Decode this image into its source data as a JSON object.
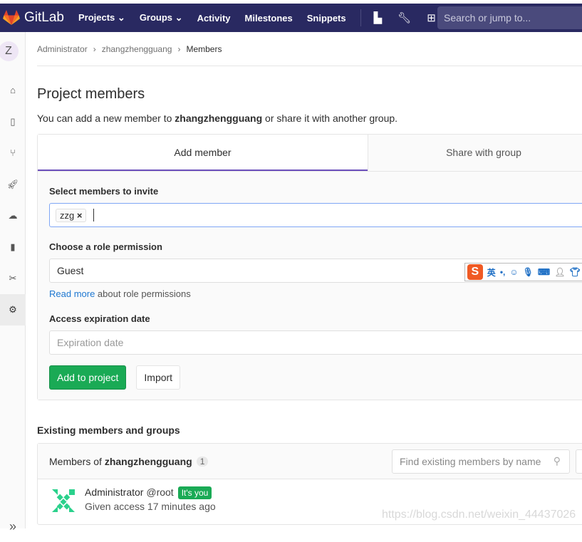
{
  "nav": {
    "brand": "GitLab",
    "items": [
      "Projects",
      "Groups",
      "Activity",
      "Milestones",
      "Snippets"
    ],
    "search_placeholder": "Search or jump to..."
  },
  "sidebar": {
    "avatar_letter": "Z",
    "items": [
      "home-icon",
      "repository-icon",
      "merge-request-icon",
      "ci-cd-icon",
      "operations-icon",
      "wiki-icon",
      "snippets-icon",
      "settings-icon"
    ],
    "active": "settings-icon"
  },
  "breadcrumb": [
    "Administrator",
    "zhangzhengguang",
    "Members"
  ],
  "page": {
    "title": "Project members",
    "lead_prefix": "You can add a new member to ",
    "lead_project": "zhangzhengguang",
    "lead_suffix": " or share it with another group."
  },
  "tabs": [
    "Add member",
    "Share with group"
  ],
  "form": {
    "select_label": "Select members to invite",
    "token": "zzg",
    "role_label": "Choose a role permission",
    "role_value": "Guest",
    "read_more": "Read more",
    "read_more_suffix": " about role permissions",
    "expiration_label": "Access expiration date",
    "expiration_placeholder": "Expiration date",
    "add_button": "Add to project",
    "import_button": "Import"
  },
  "ime": {
    "lang": "英",
    "punct": "•,"
  },
  "existing": {
    "title": "Existing members and groups",
    "members_of": "Members of ",
    "project": "zhangzhengguang",
    "count": "1",
    "find_placeholder": "Find existing members by name",
    "members": [
      {
        "name": "Administrator",
        "username": "@root",
        "badge": "It's you",
        "access": "Given access 17 minutes ago"
      }
    ]
  },
  "watermark": "https://blog.csdn.net/weixin_44437026",
  "colors": {
    "nav": "#292961",
    "accent": "#6b4fbb",
    "green": "#1aaa55",
    "link": "#1f78d1"
  }
}
